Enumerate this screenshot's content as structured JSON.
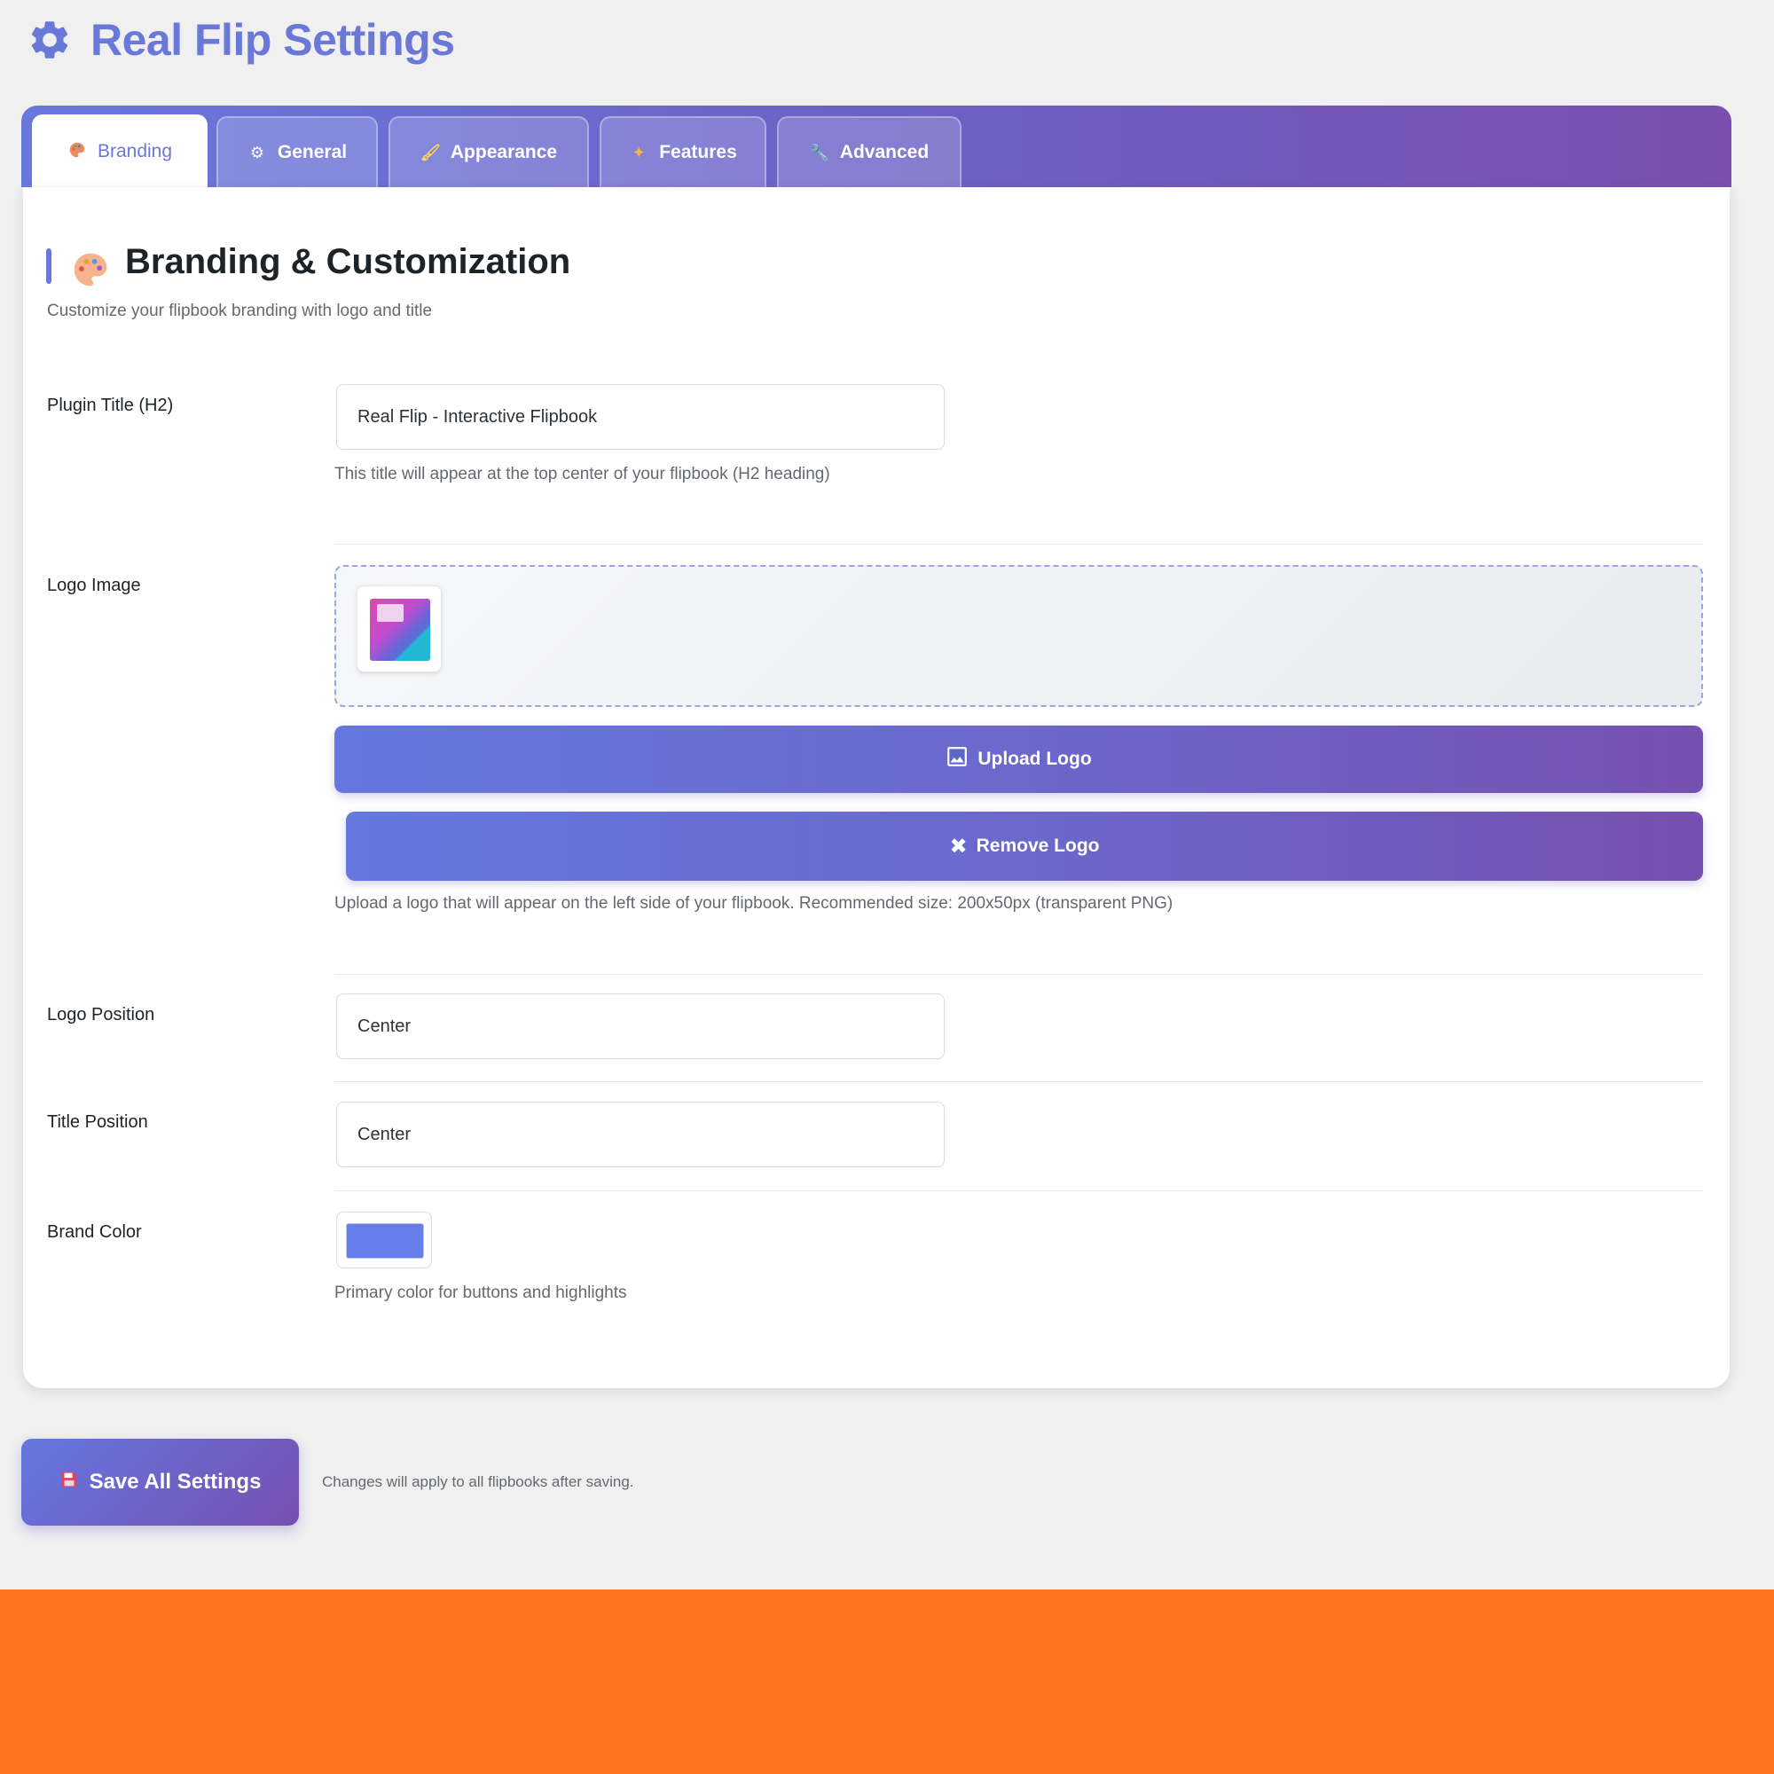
{
  "header": {
    "title": "Real Flip Settings",
    "icon": "gear-icon",
    "color": "#6a78d8"
  },
  "tabs": [
    {
      "label": "Branding",
      "icon": "palette-icon",
      "active": true
    },
    {
      "label": "General",
      "icon": "gear-icon",
      "active": false
    },
    {
      "label": "Appearance",
      "icon": "paint-icon",
      "active": false
    },
    {
      "label": "Features",
      "icon": "sparkle-icon",
      "active": false
    },
    {
      "label": "Advanced",
      "icon": "wrench-icon",
      "active": false
    }
  ],
  "section": {
    "title": "Branding & Customization",
    "subtitle": "Customize your flipbook branding with logo and title",
    "icon": "palette-icon"
  },
  "fields": {
    "plugin_title": {
      "label": "Plugin Title (H2)",
      "value": "Real Flip - Interactive Flipbook",
      "help": "This title will appear at the top center of your flipbook (H2 heading)"
    },
    "logo": {
      "label": "Logo Image",
      "upload_label": "Upload Logo",
      "remove_label": "Remove Logo",
      "help": "Upload a logo that will appear on the left side of your flipbook. Recommended size: 200x50px (transparent PNG)"
    },
    "logo_position": {
      "label": "Logo Position",
      "value": "Center"
    },
    "title_position": {
      "label": "Title Position",
      "value": "Center"
    },
    "brand_color": {
      "label": "Brand Color",
      "value": "#667eea",
      "help": "Primary color for buttons and highlights"
    }
  },
  "footer": {
    "save_label": "Save All Settings",
    "note": "Changes will apply to all flipbooks after saving."
  },
  "colors": {
    "accent": "#6a78dc",
    "gradient_end": "#7650b0",
    "footer_band": "#ff7420"
  }
}
